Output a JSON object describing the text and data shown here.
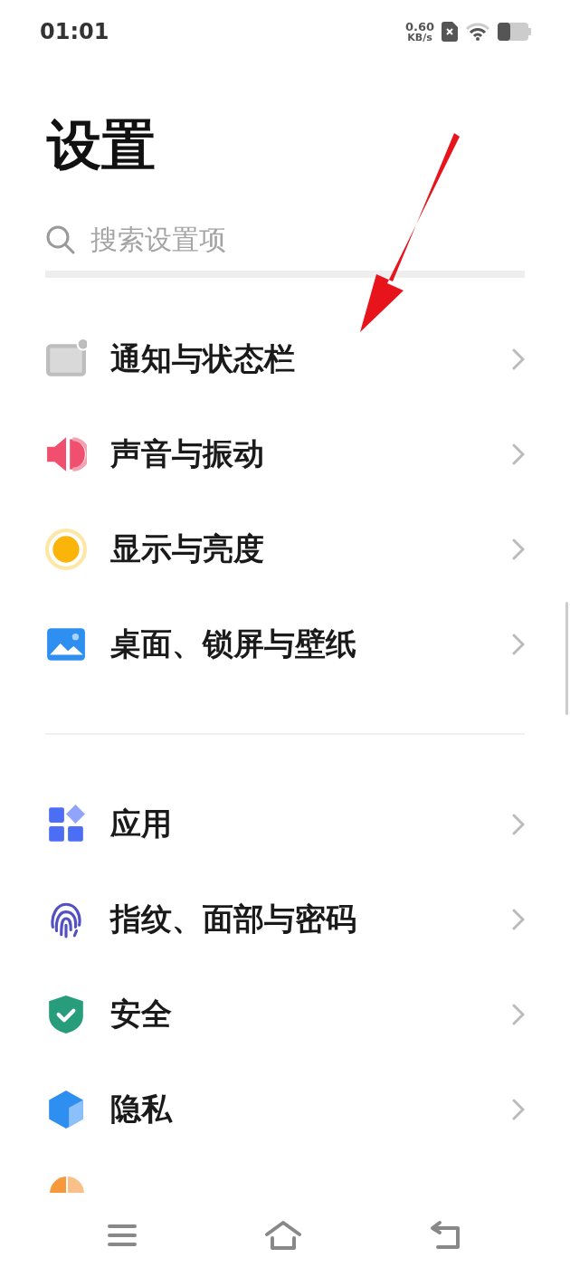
{
  "status_bar": {
    "time": "01:01",
    "speed_value": "0.60",
    "speed_unit": "KB/s"
  },
  "title": "设置",
  "search": {
    "placeholder": "搜索设置项"
  },
  "groups": [
    {
      "items": [
        {
          "label": "通知与状态栏",
          "kind": "notification"
        },
        {
          "label": "声音与振动",
          "kind": "sound"
        },
        {
          "label": "显示与亮度",
          "kind": "display"
        },
        {
          "label": "桌面、锁屏与壁纸",
          "kind": "wallpaper"
        }
      ]
    },
    {
      "items": [
        {
          "label": "应用",
          "kind": "apps"
        },
        {
          "label": "指纹、面部与密码",
          "kind": "fingerprint"
        },
        {
          "label": "安全",
          "kind": "security"
        },
        {
          "label": "隐私",
          "kind": "privacy"
        }
      ]
    }
  ]
}
